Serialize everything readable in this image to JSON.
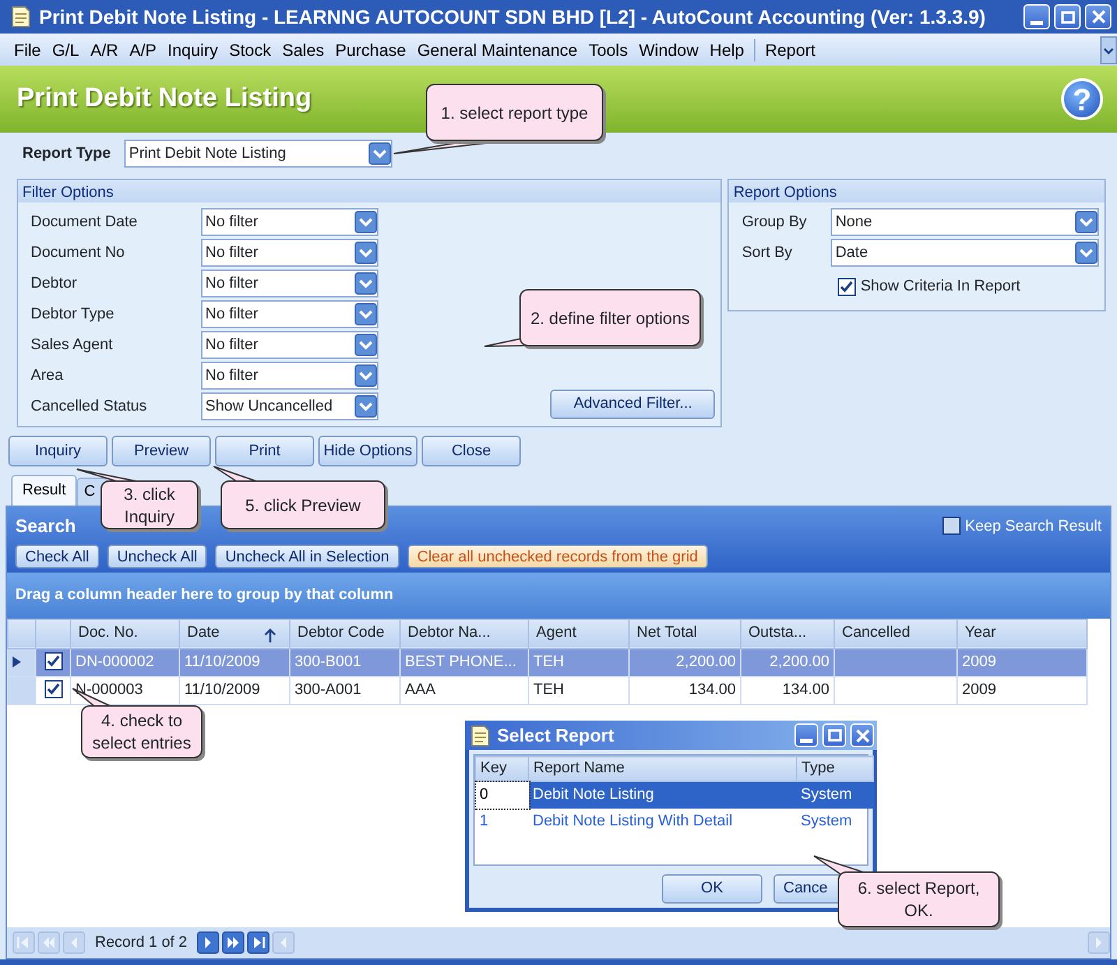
{
  "window": {
    "title": "Print Debit Note Listing - LEARNNG AUTOCOUNT SDN BHD [L2] - AutoCount Accounting (Ver: 1.3.3.9)"
  },
  "menu": [
    "File",
    "G/L",
    "A/R",
    "A/P",
    "Inquiry",
    "Stock",
    "Sales",
    "Purchase",
    "General Maintenance",
    "Tools",
    "Window",
    "Help",
    "Report"
  ],
  "header": {
    "title": "Print Debit Note Listing",
    "help": "?"
  },
  "report_type": {
    "label": "Report Type",
    "value": "Print Debit Note Listing"
  },
  "filter_options": {
    "title": "Filter Options",
    "filters": [
      {
        "label": "Document Date",
        "value": "No filter"
      },
      {
        "label": "Document No",
        "value": "No filter"
      },
      {
        "label": "Debtor",
        "value": "No filter"
      },
      {
        "label": "Debtor Type",
        "value": "No filter"
      },
      {
        "label": "Sales Agent",
        "value": "No filter"
      },
      {
        "label": "Area",
        "value": "No filter"
      },
      {
        "label": "Cancelled Status",
        "value": "Show Uncancelled"
      }
    ],
    "advanced_button": "Advanced Filter..."
  },
  "report_options": {
    "title": "Report Options",
    "group_by": {
      "label": "Group By",
      "value": "None"
    },
    "sort_by": {
      "label": "Sort By",
      "value": "Date"
    },
    "show_criteria": {
      "label": "Show Criteria In Report",
      "checked": true
    }
  },
  "actions": [
    "Inquiry",
    "Preview",
    "Print",
    "Hide Options",
    "Close"
  ],
  "tabs": [
    {
      "label": "Result",
      "selected": true
    },
    {
      "label": "C",
      "selected": false
    }
  ],
  "search_result": {
    "title": "Search",
    "keep_search": {
      "label": "Keep Search Result",
      "checked": false
    },
    "buttons": [
      {
        "label": "Check All",
        "kind": "normal"
      },
      {
        "label": "Uncheck All",
        "kind": "normal"
      },
      {
        "label": "Uncheck All in Selection",
        "kind": "normal"
      },
      {
        "label": "Clear all unchecked records from the grid",
        "kind": "warning"
      }
    ],
    "group_panel": "Drag a column header here to group by that column",
    "columns": [
      {
        "label": "Doc. No.",
        "sorted": false
      },
      {
        "label": "Date",
        "sorted": true
      },
      {
        "label": "Debtor Code",
        "sorted": false
      },
      {
        "label": "Debtor Na...",
        "sorted": false
      },
      {
        "label": "Agent",
        "sorted": false
      },
      {
        "label": "Net Total",
        "sorted": false
      },
      {
        "label": "Outsta...",
        "sorted": false
      },
      {
        "label": "Cancelled",
        "sorted": false
      },
      {
        "label": "Year",
        "sorted": false
      }
    ],
    "rows": [
      {
        "current": true,
        "checked": true,
        "cells": [
          "DN-000002",
          "11/10/2009",
          "300-B001",
          "BEST PHONE...",
          "TEH",
          "2,200.00",
          "2,200.00",
          "",
          "2009"
        ]
      },
      {
        "current": false,
        "checked": true,
        "cells": [
          "N-000003",
          "11/10/2009",
          "300-A001",
          "AAA",
          "TEH",
          "134.00",
          "134.00",
          "",
          "2009"
        ]
      }
    ],
    "navigator": "Record 1 of 2"
  },
  "dialog": {
    "title": "Select Report",
    "columns": [
      "Key",
      "Report Name",
      "Type"
    ],
    "rows": [
      {
        "selected": true,
        "cells": [
          "0",
          "Debit Note Listing",
          "System"
        ]
      },
      {
        "selected": false,
        "cells": [
          "1",
          "Debit Note Listing With Detail",
          "System"
        ]
      }
    ],
    "buttons": [
      "OK",
      "Cance"
    ]
  },
  "callouts": [
    {
      "text": "1. select report type"
    },
    {
      "text": "2. define filter options"
    },
    {
      "text": "3. click Inquiry"
    },
    {
      "text": "5. click Preview"
    },
    {
      "text": "4. check to select entries"
    },
    {
      "text": "6. select Report, OK."
    }
  ]
}
